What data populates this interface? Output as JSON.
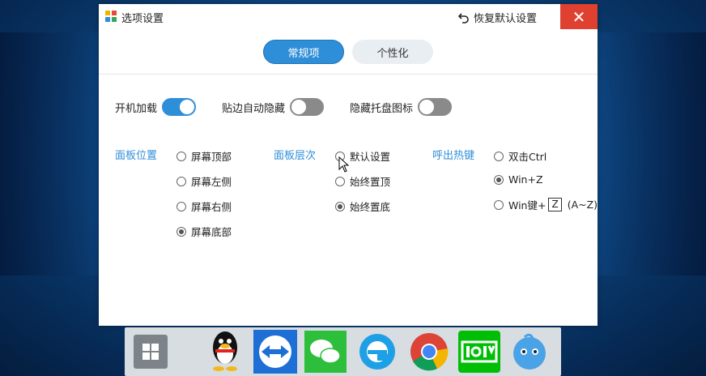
{
  "window": {
    "title": "选项设置",
    "restore_label": "恢复默认设置",
    "close_glyph": "✕"
  },
  "tabs": [
    {
      "label": "常规项",
      "active": true
    },
    {
      "label": "个性化",
      "active": false
    }
  ],
  "toggles": [
    {
      "label": "开机加载",
      "state": "on"
    },
    {
      "label": "贴边自动隐藏",
      "state": "off"
    },
    {
      "label": "隐藏托盘图标",
      "state": "off"
    }
  ],
  "groups": {
    "position": {
      "label": "面板位置",
      "options": [
        {
          "label": "屏幕顶部",
          "checked": false
        },
        {
          "label": "屏幕左侧",
          "checked": false
        },
        {
          "label": "屏幕右侧",
          "checked": false
        },
        {
          "label": "屏幕底部",
          "checked": true
        }
      ]
    },
    "layer": {
      "label": "面板层次",
      "options": [
        {
          "label": "默认设置",
          "checked": false
        },
        {
          "label": "始终置顶",
          "checked": false
        },
        {
          "label": "始终置底",
          "checked": true
        }
      ]
    },
    "hotkey": {
      "label": "呼出热键",
      "options": [
        {
          "label": "双击Ctrl",
          "checked": false
        },
        {
          "label": "Win+Z",
          "checked": true
        },
        {
          "label": "Win键+",
          "key": "Z",
          "suffix": "(A~Z)",
          "checked": false
        }
      ]
    }
  },
  "colors": {
    "accent": "#2f8ed8",
    "close_red": "#e0402f",
    "switch_off": "#8a8a8a"
  },
  "dock": [
    {
      "name": "windows-start-icon"
    },
    {
      "name": "qq-penguin-icon"
    },
    {
      "name": "teamviewer-icon"
    },
    {
      "name": "wechat-icon"
    },
    {
      "name": "ie-browser-icon"
    },
    {
      "name": "chrome-icon"
    },
    {
      "name": "iqiyi-icon"
    },
    {
      "name": "blue-bird-icon"
    }
  ]
}
